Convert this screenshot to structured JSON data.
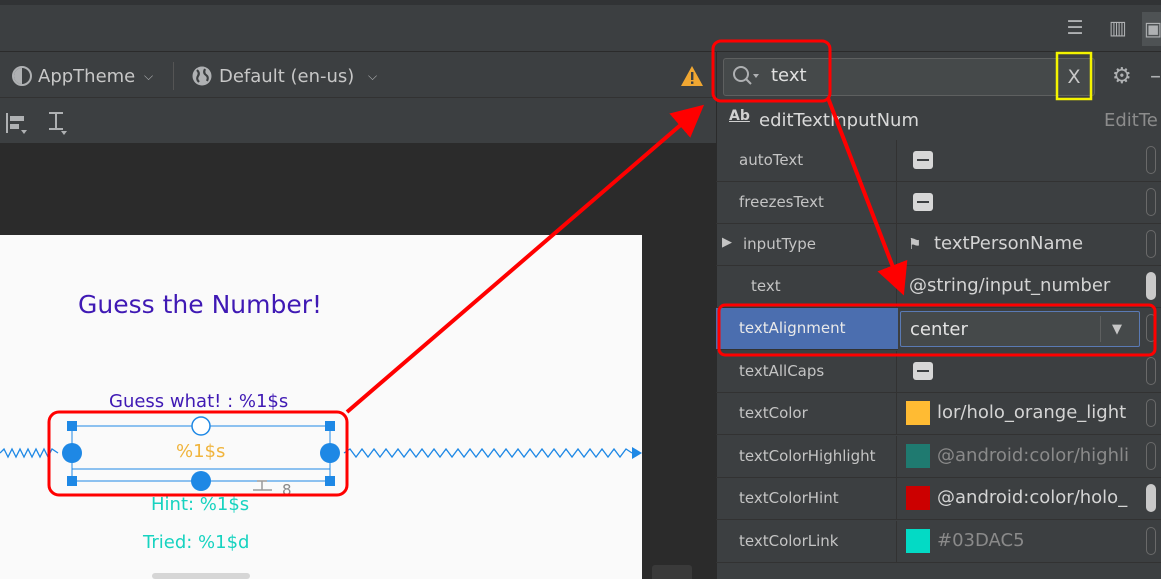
{
  "toolbar": {
    "theme_label": "AppTheme",
    "locale_label": "Default (en-us)"
  },
  "canvas": {
    "title": "Guess the Number!",
    "guess_text": "Guess what! : %1$s",
    "edit_text": "%1$s",
    "hint_text": "Hint: %1$s",
    "tried_text": "Tried: %1$d",
    "baseline_num": "8"
  },
  "search": {
    "value": "text",
    "clear_label": "X"
  },
  "component": {
    "icon_text": "Ab",
    "name": "editTextInputNum",
    "type": "EditTe"
  },
  "properties": [
    {
      "name": "autoText",
      "kind": "checkbox"
    },
    {
      "name": "freezesText",
      "kind": "checkbox"
    },
    {
      "name": "inputType",
      "kind": "flag",
      "value": "textPersonName"
    },
    {
      "name": "text",
      "kind": "text",
      "value": "@string/input_number"
    },
    {
      "name": "textAlignment",
      "kind": "combo",
      "value": "center"
    },
    {
      "name": "textAllCaps",
      "kind": "checkbox"
    },
    {
      "name": "textColor",
      "kind": "color",
      "value": "lor/holo_orange_light",
      "color": "#ffbb33"
    },
    {
      "name": "textColorHighlight",
      "kind": "color",
      "value": "@android:color/highli",
      "color": "#1f7a70"
    },
    {
      "name": "textColorHint",
      "kind": "color",
      "value": "@android:color/holo_",
      "color": "#cc0000"
    },
    {
      "name": "textColorLink",
      "kind": "color",
      "value": "#03DAC5",
      "color": "#03dac5"
    }
  ],
  "colors": {
    "annotation_red": "#ff0000",
    "annotation_yellow": "#f4f400",
    "selection_blue": "#1e88e5",
    "title_purple": "#3f19b4",
    "hint_teal": "#17d3c0",
    "edit_orange": "#f0b43c"
  }
}
